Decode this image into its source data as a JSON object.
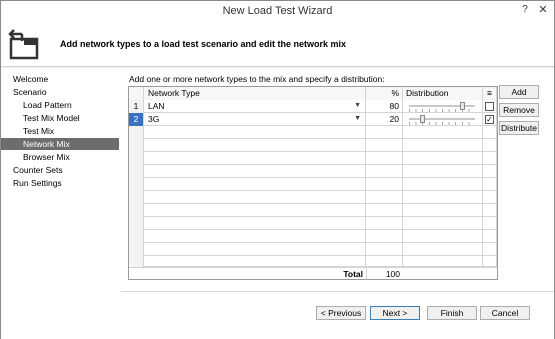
{
  "window": {
    "title": "New Load Test Wizard",
    "help": "?",
    "close": "✕"
  },
  "header": {
    "text": "Add network types to a load test scenario and edit the network mix"
  },
  "nav": {
    "items": [
      {
        "label": "Welcome"
      },
      {
        "label": "Scenario"
      },
      {
        "label": "Load Pattern"
      },
      {
        "label": "Test Mix Model"
      },
      {
        "label": "Test Mix"
      },
      {
        "label": "Network Mix",
        "selected": true
      },
      {
        "label": "Browser Mix"
      },
      {
        "label": "Counter Sets"
      },
      {
        "label": "Run Settings"
      }
    ]
  },
  "content": {
    "instruction": "Add one or more network types to the mix and specify a distribution:",
    "grid": {
      "columns": {
        "type": "Network Type",
        "percent": "%",
        "distribution": "Distribution",
        "lock": "≡"
      },
      "rows": [
        {
          "num": "1",
          "type": "LAN",
          "percent": "80",
          "distribution": 0.8,
          "locked": false
        },
        {
          "num": "2",
          "type": "3G",
          "percent": "20",
          "distribution": 0.2,
          "locked": true
        }
      ],
      "total_label": "Total",
      "total_value": "100"
    },
    "buttons": {
      "add": "Add",
      "remove": "Remove",
      "distribute": "Distribute"
    }
  },
  "footer": {
    "previous": "< Previous",
    "next": "Next >",
    "finish": "Finish",
    "cancel": "Cancel"
  }
}
